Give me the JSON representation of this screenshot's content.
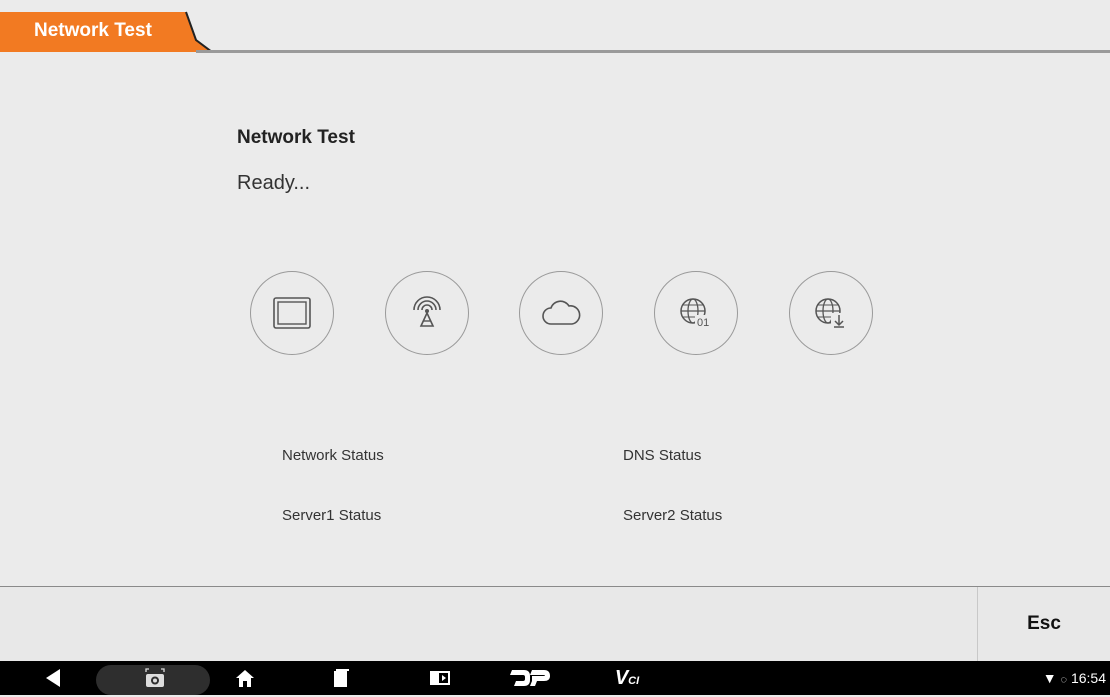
{
  "tab": {
    "label": "Network Test"
  },
  "main": {
    "title": "Network Test",
    "status": "Ready..."
  },
  "icons": [
    {
      "name": "device-screen-icon"
    },
    {
      "name": "signal-tower-icon"
    },
    {
      "name": "cloud-icon"
    },
    {
      "name": "globe-data-icon"
    },
    {
      "name": "globe-download-icon"
    }
  ],
  "labels": {
    "network_status": "Network Status",
    "dns_status": "DNS Status",
    "server1_status": "Server1 Status",
    "server2_status": "Server2 Status"
  },
  "bottom": {
    "esc_label": "Esc"
  },
  "navbar": {
    "time": "16:54"
  },
  "colors": {
    "accent": "#f27a22",
    "text": "#222222",
    "background": "#ebebeb"
  }
}
